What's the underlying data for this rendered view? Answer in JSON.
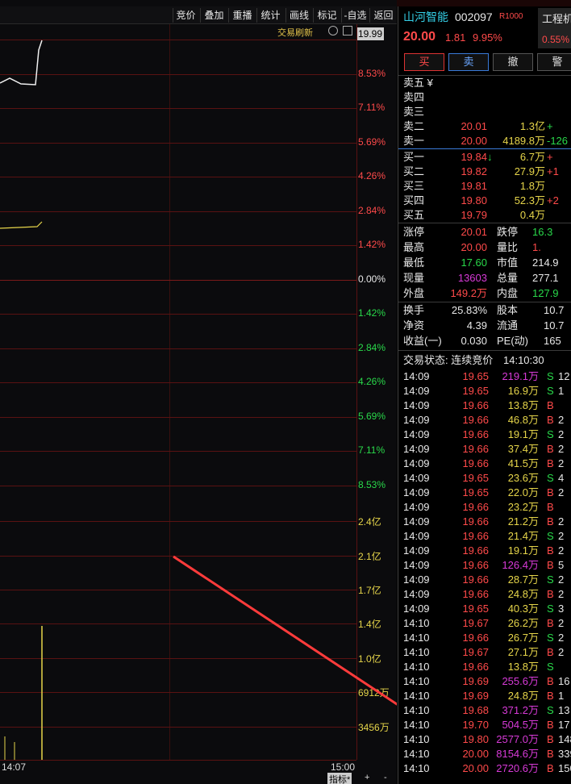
{
  "toolbar": {
    "items": [
      "竞价",
      "叠加",
      "重播",
      "统计",
      "画线",
      "标记",
      "-自选",
      "返回"
    ]
  },
  "chart": {
    "refresh_label": "交易刷新",
    "price_tag": "19.99",
    "pct_labels": [
      "8.53%",
      "7.11%",
      "5.69%",
      "4.26%",
      "2.84%",
      "1.42%",
      "0.00%",
      "1.42%",
      "2.84%",
      "4.26%",
      "5.69%",
      "7.11%",
      "8.53%"
    ],
    "vol_labels": [
      "2.4亿",
      "2.1亿",
      "1.7亿",
      "1.4亿",
      "1.0亿",
      "6912万",
      "3456万"
    ],
    "time_start": "14:07",
    "time_end": "15:00",
    "bottom_label": "指标*",
    "bottom_plus": "+",
    "bottom_minus": "-"
  },
  "stock": {
    "name": "山河智能",
    "code": "002097",
    "tag": "R1000",
    "price": "20.00",
    "change": "1.81",
    "change_pct": "9.95%",
    "sector_name": "工程机",
    "sector_pct": "0.55%"
  },
  "actions": [
    "买",
    "卖",
    "撤",
    "警"
  ],
  "order_book": {
    "sell": [
      {
        "label": "卖五 ¥",
        "price": "",
        "vol": "",
        "chg": ""
      },
      {
        "label": "卖四",
        "price": "",
        "vol": "",
        "chg": ""
      },
      {
        "label": "卖三",
        "price": "",
        "vol": "",
        "chg": ""
      },
      {
        "label": "卖二",
        "price": "20.01",
        "vol": "1.3亿",
        "chg": "+"
      },
      {
        "label": "卖一",
        "price": "20.00",
        "vol": "4189.8万",
        "chg": "-126"
      }
    ],
    "buy": [
      {
        "label": "买一",
        "price": "19.84",
        "arrow": "↓",
        "vol": "6.7万",
        "chg": "+"
      },
      {
        "label": "买二",
        "price": "19.82",
        "arrow": "",
        "vol": "27.9万",
        "chg": "+1"
      },
      {
        "label": "买三",
        "price": "19.81",
        "arrow": "",
        "vol": "1.8万",
        "chg": ""
      },
      {
        "label": "买四",
        "price": "19.80",
        "arrow": "",
        "vol": "52.3万",
        "chg": "+2"
      },
      {
        "label": "买五",
        "price": "19.79",
        "arrow": "",
        "vol": "0.4万",
        "chg": ""
      }
    ]
  },
  "stats": {
    "zhangting_l": "涨停",
    "zhangting_v": "20.01",
    "dieting_l": "跌停",
    "dieting_v": "16.3",
    "zuigao_l": "最高",
    "zuigao_v": "20.00",
    "liangbi_l": "量比",
    "liangbi_v": "1.",
    "zuidi_l": "最低",
    "zuidi_v": "17.60",
    "shizhi_l": "市值",
    "shizhi_v": "214.9",
    "xianliang_l": "现量",
    "xianliang_v": "13603",
    "zongliang_l": "总量",
    "zongliang_v": "277.1",
    "waipan_l": "外盘",
    "waipan_v": "149.2万",
    "neipan_l": "内盘",
    "neipan_v": "127.9",
    "huanshou_l": "换手",
    "huanshou_v": "25.83%",
    "guben_l": "股本",
    "guben_v": "10.7",
    "jingzi_l": "净资",
    "jingzi_v": "4.39",
    "liutong_l": "流通",
    "liutong_v": "10.7",
    "shouyi_l": "收益(一)",
    "shouyi_v": "0.030",
    "pe_l": "PE(动)",
    "pe_v": "165"
  },
  "status": {
    "label": "交易状态: 连续竞价",
    "time": "14:10:30"
  },
  "ticks": [
    {
      "t": "14:09",
      "p": "19.65",
      "v": "219.1万",
      "s": "S",
      "n": "12"
    },
    {
      "t": "14:09",
      "p": "19.65",
      "v": "16.9万",
      "s": "S",
      "n": "1"
    },
    {
      "t": "14:09",
      "p": "19.66",
      "v": "13.8万",
      "s": "B",
      "n": ""
    },
    {
      "t": "14:09",
      "p": "19.66",
      "v": "46.8万",
      "s": "B",
      "n": "2"
    },
    {
      "t": "14:09",
      "p": "19.66",
      "v": "19.1万",
      "s": "S",
      "n": "2"
    },
    {
      "t": "14:09",
      "p": "19.66",
      "v": "37.4万",
      "s": "B",
      "n": "2"
    },
    {
      "t": "14:09",
      "p": "19.66",
      "v": "41.5万",
      "s": "B",
      "n": "2"
    },
    {
      "t": "14:09",
      "p": "19.65",
      "v": "23.6万",
      "s": "S",
      "n": "4"
    },
    {
      "t": "14:09",
      "p": "19.65",
      "v": "22.0万",
      "s": "B",
      "n": "2"
    },
    {
      "t": "14:09",
      "p": "19.66",
      "v": "23.2万",
      "s": "B",
      "n": ""
    },
    {
      "t": "14:09",
      "p": "19.66",
      "v": "21.2万",
      "s": "B",
      "n": "2"
    },
    {
      "t": "14:09",
      "p": "19.66",
      "v": "21.4万",
      "s": "S",
      "n": "2"
    },
    {
      "t": "14:09",
      "p": "19.66",
      "v": "19.1万",
      "s": "B",
      "n": "2"
    },
    {
      "t": "14:09",
      "p": "19.66",
      "v": "126.4万",
      "s": "B",
      "n": "5"
    },
    {
      "t": "14:09",
      "p": "19.66",
      "v": "28.7万",
      "s": "S",
      "n": "2"
    },
    {
      "t": "14:09",
      "p": "19.66",
      "v": "24.8万",
      "s": "B",
      "n": "2"
    },
    {
      "t": "14:09",
      "p": "19.65",
      "v": "40.3万",
      "s": "S",
      "n": "3"
    },
    {
      "t": "14:10",
      "p": "19.67",
      "v": "26.2万",
      "s": "B",
      "n": "2"
    },
    {
      "t": "14:10",
      "p": "19.66",
      "v": "26.7万",
      "s": "S",
      "n": "2"
    },
    {
      "t": "14:10",
      "p": "19.67",
      "v": "27.1万",
      "s": "B",
      "n": "2"
    },
    {
      "t": "14:10",
      "p": "19.66",
      "v": "13.8万",
      "s": "S",
      "n": ""
    },
    {
      "t": "14:10",
      "p": "19.69",
      "v": "255.6万",
      "s": "B",
      "n": "16"
    },
    {
      "t": "14:10",
      "p": "19.69",
      "v": "24.8万",
      "s": "B",
      "n": "1"
    },
    {
      "t": "14:10",
      "p": "19.68",
      "v": "371.2万",
      "s": "S",
      "n": "13"
    },
    {
      "t": "14:10",
      "p": "19.70",
      "v": "504.5万",
      "s": "B",
      "n": "17"
    },
    {
      "t": "14:10",
      "p": "19.80",
      "v": "2577.0万",
      "s": "B",
      "n": "148"
    },
    {
      "t": "14:10",
      "p": "20.00",
      "v": "8154.6万",
      "s": "B",
      "n": "339"
    },
    {
      "t": "14:10",
      "p": "20.00",
      "v": "2720.6万",
      "s": "B",
      "n": "150"
    }
  ]
}
